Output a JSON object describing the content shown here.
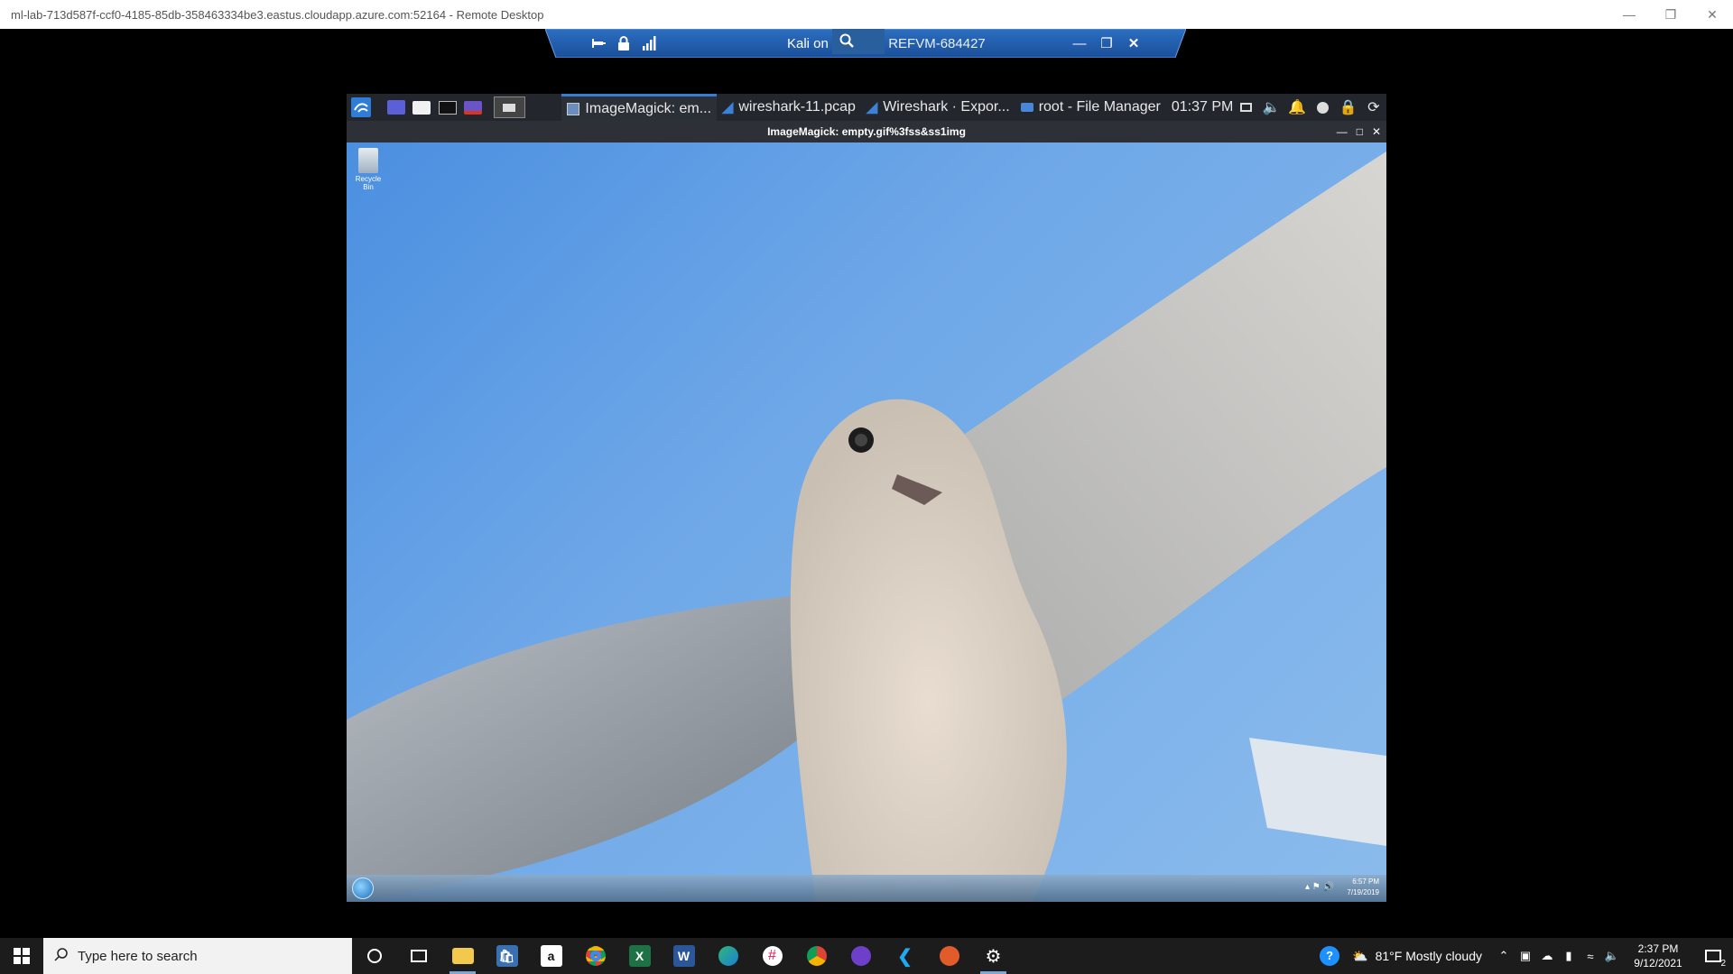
{
  "remote_desktop": {
    "title": "ml-lab-713d587f-ccf0-4185-85db-358463334be3.eastus.cloudapp.azure.com:52164 - Remote Desktop"
  },
  "connection_bar": {
    "title": "Kali on ",
    "title_suffix": "REFVM-684427"
  },
  "kali_panel": {
    "tasks": [
      {
        "label": "ImageMagick: em..."
      },
      {
        "label": "wireshark-11.pcap"
      },
      {
        "label": "Wireshark · Expor..."
      },
      {
        "label": "root - File Manager"
      }
    ],
    "clock": "01:37 PM"
  },
  "imagemagick": {
    "title": "ImageMagick: empty.gif%3fss&ss1img"
  },
  "win7": {
    "recycle_bin": "Recycle Bin",
    "time": "6:57 PM",
    "date": "7/19/2019"
  },
  "win10_taskbar": {
    "search_placeholder": "Type here to search",
    "weather": "81°F  Mostly cloudy",
    "time": "2:37 PM",
    "date": "9/12/2021",
    "notification_count": "2"
  },
  "colors": {
    "kali_panel": "#23262c",
    "sky": "#6fa8e8",
    "accent": "#3a7bd5"
  }
}
